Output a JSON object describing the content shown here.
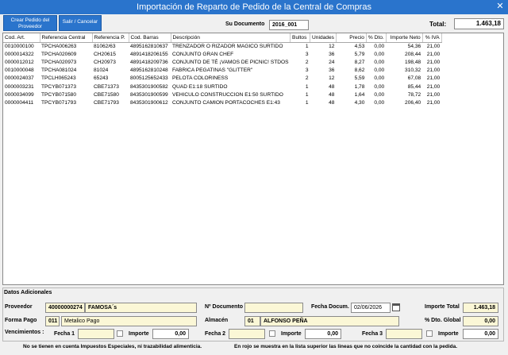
{
  "window": {
    "title": "Importación de Reparto de Pedido de la Central de Compras"
  },
  "toolbar": {
    "create_order_line1": "Crear Pedido del",
    "create_order_line2": "Proveedor",
    "exit_label": "Salir / Cancelar"
  },
  "header": {
    "document_label": "Su Documento",
    "document_value": "2016_001",
    "total_label": "Total:",
    "total_value": "1.463,18"
  },
  "table": {
    "columns": [
      "Cod. Art.",
      "Referencia Central",
      "Referencia P.",
      "Cod. Barras",
      "Descripción",
      "Bultos",
      "Unidades",
      "Precio",
      "% Dto.",
      "Importe Neto",
      "% IVA"
    ],
    "rows": [
      [
        "0010000100",
        "TPCHA006263",
        "81062/63",
        "4895162810637",
        "TRENZADOR O RIZADOR MAGICO SURTIDO",
        "1",
        "12",
        "4,53",
        "0,00",
        "54,36",
        "21,00"
      ],
      [
        "0000014322",
        "TPCHA020609",
        "CH20615",
        "4891418206155",
        "CONJUNTO GRAN CHEF",
        "3",
        "36",
        "5,79",
        "0,00",
        "208,44",
        "21,00"
      ],
      [
        "0000012012",
        "TPCHA020973",
        "CH20973",
        "4891418209736",
        "CONJUNTO DE TÉ ¡VAMOS DE PICNIC! STDOS",
        "2",
        "24",
        "8,27",
        "0,00",
        "198,48",
        "21,00"
      ],
      [
        "0010000048",
        "TPCHA081024",
        "81024",
        "4895162810248",
        "FABRICA PEGATINAS \"GLITTER\"",
        "3",
        "36",
        "8,62",
        "0,00",
        "310,32",
        "21,00"
      ],
      [
        "0000024037",
        "TPCLH065243",
        "65243",
        "8005125652433",
        "PELOTA COLORINESS",
        "2",
        "12",
        "5,59",
        "0,00",
        "67,08",
        "21,00"
      ],
      [
        "0000003231",
        "TPCYB071373",
        "CBE71373",
        "8435301900582",
        "QUAD E1:18 SURTIDO",
        "1",
        "48",
        "1,78",
        "0,00",
        "85,44",
        "21,00"
      ],
      [
        "0000034099",
        "TPCYB071580",
        "CBE71580",
        "8435301900599",
        "VEHICULO CONSTRUCCION E1:50 SURTIDO",
        "1",
        "48",
        "1,64",
        "0,00",
        "78,72",
        "21,00"
      ],
      [
        "0000004411",
        "TPCYB071793",
        "CBE71793",
        "8435301900612",
        "CONJUNTO CAMION PORTACOCHES E1:43",
        "1",
        "48",
        "4,30",
        "0,00",
        "206,40",
        "21,00"
      ]
    ]
  },
  "details": {
    "section_title": "Datos Adicionales",
    "proveedor_label": "Proveedor",
    "proveedor_code": "40000000274",
    "proveedor_name": "FAMOSA´s",
    "num_doc_label": "Nº Documento",
    "num_doc_value": "",
    "fecha_doc_label": "Fecha Docum.",
    "fecha_doc_value": "02/06/2026",
    "importe_total_label": "Importe Total",
    "importe_total_value": "1.463,18",
    "forma_pago_label": "Forma Pago",
    "forma_pago_code": "011",
    "forma_pago_name": "Metalico Pago",
    "almacen_label": "Almacén",
    "almacen_code": "01",
    "almacen_name": "ALFONSO PEÑA",
    "dto_global_label": "% Dto. Global",
    "dto_global_value": "0,00",
    "vencimientos_label": "Vencimientos :",
    "fecha1_label": "Fecha 1",
    "fecha2_label": "Fecha 2",
    "fecha3_label": "Fecha 3",
    "importe_label": "Importe",
    "importe1_value": "0,00",
    "importe2_value": "0,00",
    "importe3_value": "0,00",
    "importe_extra_value": "0,00"
  },
  "footer": {
    "note1": "No se tienen en cuenta Impuestos Especiales, ni trazabilidad alimenticia.",
    "note2": "En rojo se muestra en la lista superior las lineas que no coincide la cantidad con la pedida."
  },
  "colors": {
    "titlebar": "#2a74cc",
    "field_yellow": "#fbf7d6"
  }
}
